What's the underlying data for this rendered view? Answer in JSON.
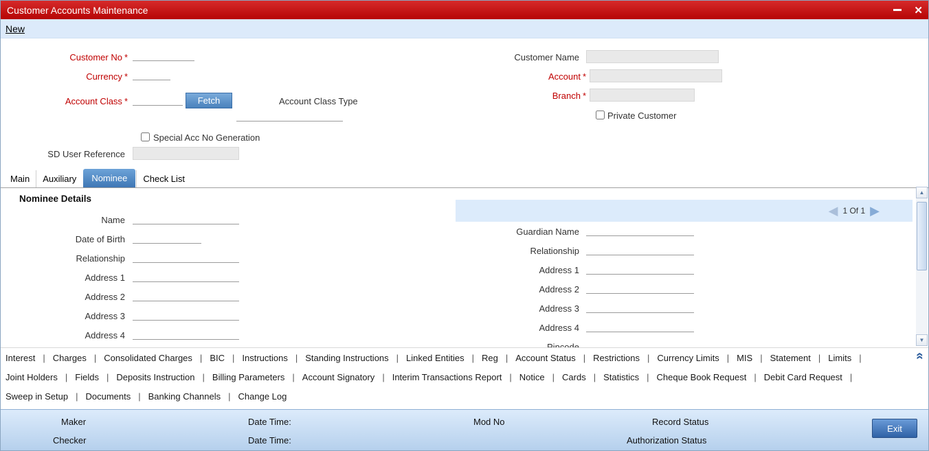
{
  "window": {
    "title": "Customer Accounts Maintenance"
  },
  "toolbar": {
    "new_label": "New"
  },
  "required_marker": "*",
  "form": {
    "customer_no": {
      "label": "Customer No",
      "value": ""
    },
    "currency": {
      "label": "Currency",
      "value": ""
    },
    "account_class": {
      "label": "Account Class",
      "value": ""
    },
    "fetch_button_label": "Fetch",
    "account_class_type": {
      "label": "Account Class Type",
      "value": ""
    },
    "special_acc_no_generation": {
      "label": "Special Acc No Generation",
      "checked": false
    },
    "sd_user_reference": {
      "label": "SD User Reference",
      "value": ""
    },
    "customer_name": {
      "label": "Customer Name",
      "value": ""
    },
    "account": {
      "label": "Account",
      "value": ""
    },
    "branch": {
      "label": "Branch",
      "value": ""
    },
    "private_customer": {
      "label": "Private Customer",
      "checked": false
    }
  },
  "tabs": [
    {
      "label": "Main",
      "active": false
    },
    {
      "label": "Auxiliary",
      "active": false
    },
    {
      "label": "Nominee",
      "active": true
    },
    {
      "label": "Check List",
      "active": false
    }
  ],
  "nominee": {
    "section_title": "Nominee Details",
    "pager_text": "1 Of 1",
    "left_fields": [
      {
        "label": "Name",
        "value": ""
      },
      {
        "label": "Date of Birth",
        "value": ""
      },
      {
        "label": "Relationship",
        "value": ""
      },
      {
        "label": "Address 1",
        "value": ""
      },
      {
        "label": "Address 2",
        "value": ""
      },
      {
        "label": "Address 3",
        "value": ""
      },
      {
        "label": "Address 4",
        "value": ""
      }
    ],
    "right_fields": [
      {
        "label": "Guardian Name",
        "value": ""
      },
      {
        "label": "Relationship",
        "value": ""
      },
      {
        "label": "Address 1",
        "value": ""
      },
      {
        "label": "Address 2",
        "value": ""
      },
      {
        "label": "Address 3",
        "value": ""
      },
      {
        "label": "Address 4",
        "value": ""
      },
      {
        "label": "Pincode",
        "value": ""
      }
    ]
  },
  "action_links": {
    "row1": [
      "Interest",
      "Charges",
      "Consolidated Charges",
      "BIC",
      "Instructions",
      "Standing Instructions",
      "Linked Entities",
      "Reg",
      "Account Status",
      "Restrictions",
      "Currency Limits",
      "MIS",
      "Statement",
      "Limits"
    ],
    "row2": [
      "Joint Holders",
      "Fields",
      "Deposits Instruction",
      "Billing Parameters",
      "Account Signatory",
      "Interim Transactions Report",
      "Notice",
      "Cards",
      "Statistics",
      "Cheque Book Request",
      "Debit Card Request"
    ],
    "row3": [
      "Sweep in Setup",
      "Documents",
      "Banking Channels",
      "Change Log"
    ]
  },
  "footer": {
    "maker_label": "Maker",
    "checker_label": "Checker",
    "date_time_label_1": "Date Time:",
    "date_time_label_2": "Date Time:",
    "mod_no_label": "Mod No",
    "record_status_label": "Record Status",
    "authorization_status_label": "Authorization Status",
    "exit_button_label": "Exit"
  },
  "colors": {
    "titlebar_red": "#c00a0a",
    "required_red": "#c00000",
    "active_tab_blue": "#4d87c3",
    "footer_blue": "#cfe2f6"
  }
}
